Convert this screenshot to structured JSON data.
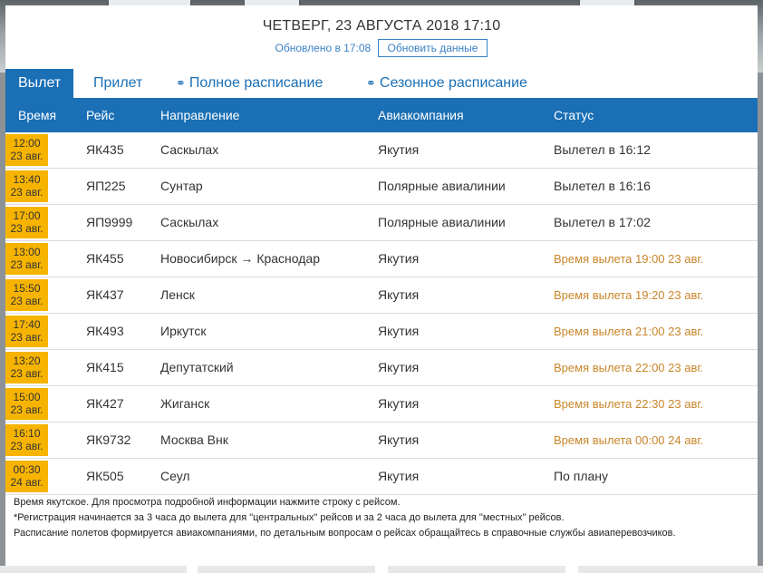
{
  "header": {
    "date_time": "ЧЕТВЕРГ, 23 АВГУСТА 2018 17:10",
    "updated_text": "Обновлено в 17:08",
    "refresh_label": "Обновить данные"
  },
  "tabs": [
    {
      "label": "Вылет",
      "active": true
    },
    {
      "label": "Прилет",
      "active": false
    },
    {
      "label": "Полное расписание",
      "active": false,
      "icon": "link-icon"
    },
    {
      "label": "Сезонное расписание",
      "active": false,
      "icon": "link-icon"
    }
  ],
  "columns": [
    "Время",
    "Рейс",
    "Направление",
    "Авиакомпания",
    "Статус"
  ],
  "flights": [
    {
      "time": "12:00",
      "date": "23 авг.",
      "flight": "ЯК435",
      "direction": "Саскылах",
      "airline": "Якутия",
      "status": "Вылетел в 16:12"
    },
    {
      "time": "13:40",
      "date": "23 авг.",
      "flight": "ЯП225",
      "direction": "Сунтар",
      "airline": "Полярные авиалинии",
      "status": "Вылетел в 16:16"
    },
    {
      "time": "17:00",
      "date": "23 авг.",
      "flight": "ЯП9999",
      "direction": "Саскылах",
      "airline": "Полярные авиалинии",
      "status": "Вылетел в 17:02"
    },
    {
      "time": "13:00",
      "date": "23 авг.",
      "flight": "ЯК455",
      "direction": "Новосибирск → Краснодар",
      "airline": "Якутия",
      "status": "Время вылета 19:00 23 авг."
    },
    {
      "time": "15:50",
      "date": "23 авг.",
      "flight": "ЯК437",
      "direction": "Ленск",
      "airline": "Якутия",
      "status": "Время вылета 19:20 23 авг."
    },
    {
      "time": "17:40",
      "date": "23 авг.",
      "flight": "ЯК493",
      "direction": "Иркутск",
      "airline": "Якутия",
      "status": "Время вылета 21:00 23 авг."
    },
    {
      "time": "13:20",
      "date": "23 авг.",
      "flight": "ЯК415",
      "direction": "Депутатский",
      "airline": "Якутия",
      "status": "Время вылета 22:00 23 авг."
    },
    {
      "time": "15:00",
      "date": "23 авг.",
      "flight": "ЯК427",
      "direction": "Жиганск",
      "airline": "Якутия",
      "status": "Время вылета 22:30 23 авг."
    },
    {
      "time": "16:10",
      "date": "23 авг.",
      "flight": "ЯК9732",
      "direction": "Москва Внк",
      "airline": "Якутия",
      "status": "Время вылета 00:00 24 авг."
    },
    {
      "time": "00:30",
      "date": "24 авг.",
      "flight": "ЯК505",
      "direction": "Сеул",
      "airline": "Якутия",
      "status": "По плану"
    }
  ],
  "notes": [
    "Время якутское. Для просмотра подробной информации нажмите строку с рейсом.",
    "*Регистрация начинается за 3 часа до вылета для \"центральных\" рейсов и за 2 часа до вылета для \"местных\" рейсов.",
    "Расписание полетов формируется авиакомпаниями, по детальным вопросам о рейсах обращайтесь в справочные службы авиаперевозчиков."
  ],
  "colors": {
    "accent": "#1a6fb5",
    "time_badge": "#f6b400",
    "status_delayed": "#c9862a"
  }
}
